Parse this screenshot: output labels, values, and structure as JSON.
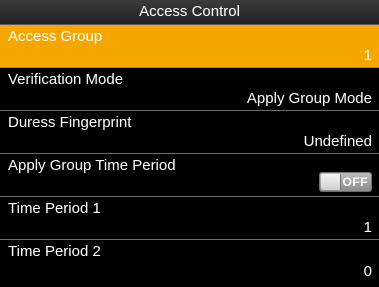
{
  "header": {
    "title": "Access Control"
  },
  "items": [
    {
      "label": "Access Group",
      "value": "1"
    },
    {
      "label": "Verification Mode",
      "value": "Apply Group Mode"
    },
    {
      "label": "Duress Fingerprint",
      "value": "Undefined"
    },
    {
      "label": "Apply Group Time Period",
      "toggle_text": "OFF"
    },
    {
      "label": "Time Period 1",
      "value": "1"
    },
    {
      "label": "Time Period 2",
      "value": "0"
    }
  ],
  "colors": {
    "selected_background": "#f5a700",
    "background": "#000000"
  },
  "icons": {
    "toggle": "toggle-switch-off-icon"
  }
}
